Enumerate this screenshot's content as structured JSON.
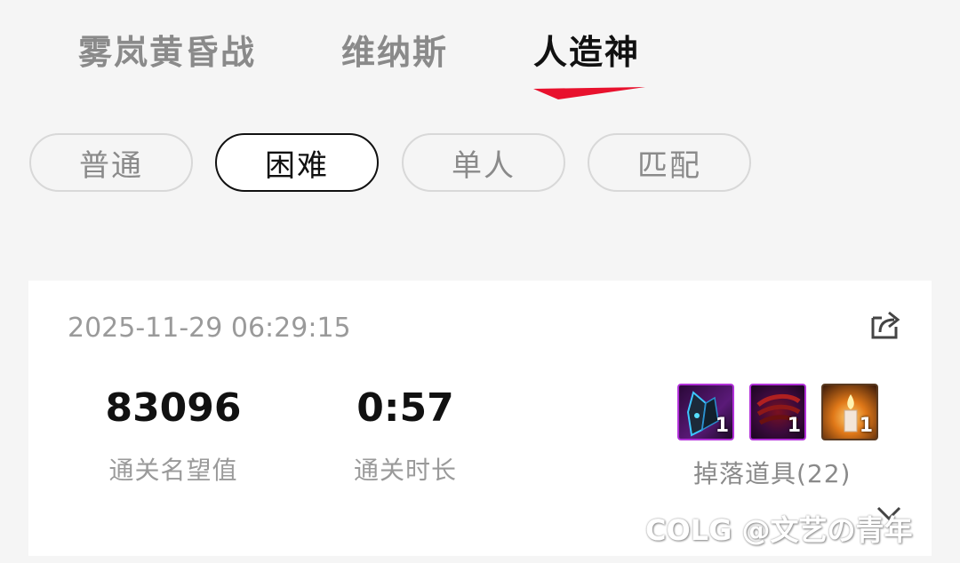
{
  "tabs": [
    {
      "label": "雾岚黄昏战",
      "active": false
    },
    {
      "label": "维纳斯",
      "active": false
    },
    {
      "label": "人造神",
      "active": true
    }
  ],
  "difficulties": [
    {
      "label": "普通",
      "selected": false
    },
    {
      "label": "困难",
      "selected": true
    },
    {
      "label": "单人",
      "selected": false
    },
    {
      "label": "匹配",
      "selected": false
    }
  ],
  "record": {
    "timestamp": "2025-11-29 06:29:15",
    "reputation": {
      "value": "83096",
      "label": "通关名望值"
    },
    "duration": {
      "value": "0:57",
      "label": "通关时长"
    },
    "drops": {
      "label": "掉落道具(22)",
      "items": [
        {
          "icon": "dark-armor-item-icon",
          "count": "1"
        },
        {
          "icon": "red-claw-item-icon",
          "count": "1"
        },
        {
          "icon": "candle-item-icon",
          "count": "1"
        }
      ]
    }
  },
  "watermark": "COLG @文艺の青年",
  "colors": {
    "accent": "#e8112d",
    "active_text": "#111111",
    "muted_text": "#8a8a8a"
  }
}
